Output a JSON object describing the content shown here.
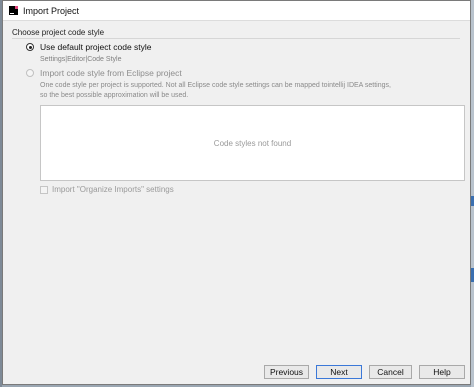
{
  "window": {
    "title": "Import Project",
    "icon": "intellij-app-icon"
  },
  "section": {
    "label": "Choose project code style"
  },
  "options": {
    "default_label": "Use default project code style",
    "default_hint": "Settings|Editor|Code Style",
    "eclipse_label": "Import code style from Eclipse project",
    "eclipse_desc_line1": "One code style per project is supported. Not all Eclipse code style settings can be mapped tointellij IDEA settings,",
    "eclipse_desc_line2": "so the best possible approximation will be used.",
    "selected": "default"
  },
  "list": {
    "empty_text": "Code styles not found"
  },
  "organize_imports": {
    "label": "Import \"Organize Imports\" settings",
    "checked": false
  },
  "buttons": {
    "previous": "Previous",
    "next": "Next",
    "cancel": "Cancel",
    "help": "Help"
  }
}
